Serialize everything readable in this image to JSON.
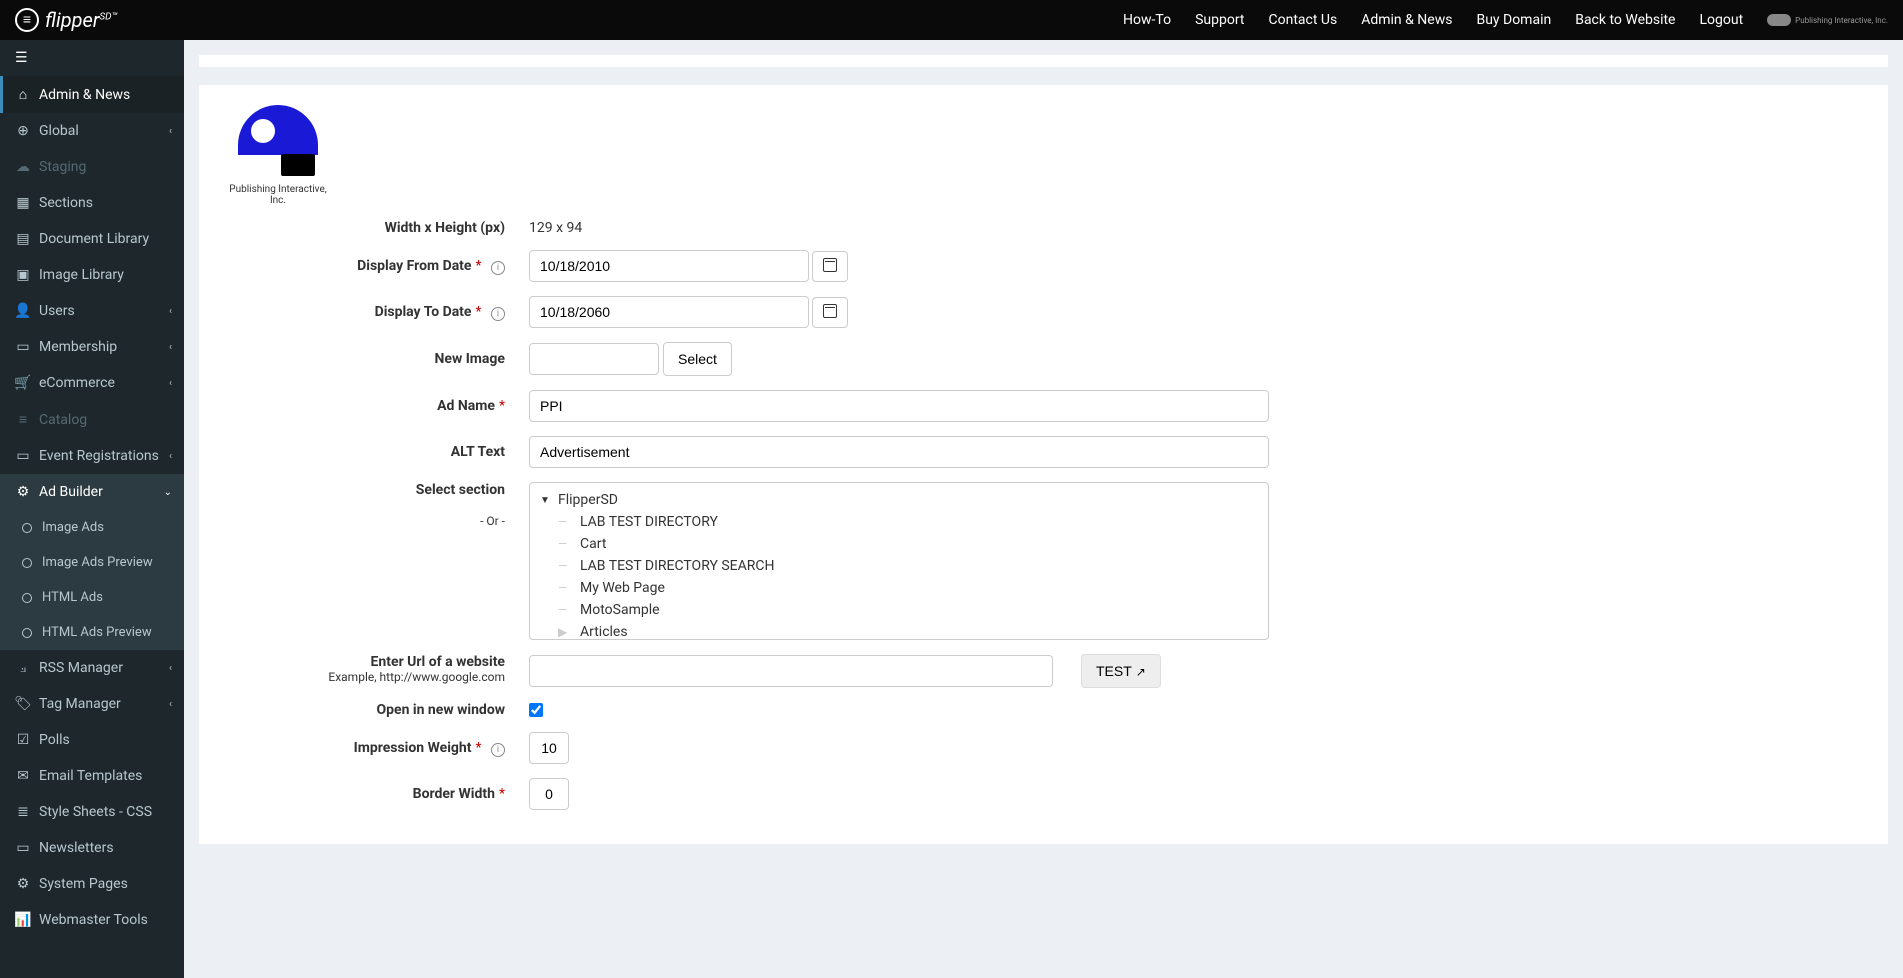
{
  "brand": {
    "name": "flipper",
    "suffix": "SD™"
  },
  "topNav": {
    "items": [
      "How-To",
      "Support",
      "Contact Us",
      "Admin & News",
      "Buy Domain",
      "Back to Website",
      "Logout"
    ],
    "partner": "Publishing Interactive, Inc."
  },
  "sidebar": {
    "items": [
      {
        "label": "Admin & News",
        "icon": "home",
        "active": true
      },
      {
        "label": "Global",
        "icon": "globe",
        "chevron": true
      },
      {
        "label": "Staging",
        "icon": "cloud",
        "muted": true
      },
      {
        "label": "Sections",
        "icon": "grid"
      },
      {
        "label": "Document Library",
        "icon": "file"
      },
      {
        "label": "Image Library",
        "icon": "image"
      },
      {
        "label": "Users",
        "icon": "user",
        "chevron": true
      },
      {
        "label": "Membership",
        "icon": "card",
        "chevron": true
      },
      {
        "label": "eCommerce",
        "icon": "cart",
        "chevron": true
      },
      {
        "label": "Catalog",
        "icon": "list",
        "muted": true
      },
      {
        "label": "Event Registrations",
        "icon": "calendar-rect",
        "chevron": true
      },
      {
        "label": "Ad Builder",
        "icon": "cogs",
        "expanded": true,
        "chevron": "down",
        "children": [
          {
            "label": "Image Ads"
          },
          {
            "label": "Image Ads Preview"
          },
          {
            "label": "HTML Ads"
          },
          {
            "label": "HTML Ads Preview"
          }
        ]
      },
      {
        "label": "RSS Manager",
        "icon": "rss",
        "chevron": true
      },
      {
        "label": "Tag Manager",
        "icon": "tag",
        "chevron": true
      },
      {
        "label": "Polls",
        "icon": "check-square"
      },
      {
        "label": "Email Templates",
        "icon": "envelope"
      },
      {
        "label": "Style Sheets - CSS",
        "icon": "layers"
      },
      {
        "label": "Newsletters",
        "icon": "news"
      },
      {
        "label": "System Pages",
        "icon": "cog"
      },
      {
        "label": "Webmaster Tools",
        "icon": "chart"
      }
    ]
  },
  "form": {
    "logoCaption": "Publishing Interactive, Inc.",
    "labels": {
      "widthHeight": "Width x Height (px)",
      "displayFrom": "Display From Date",
      "displayTo": "Display To Date",
      "newImage": "New Image",
      "adName": "Ad Name",
      "altText": "ALT Text",
      "selectSection": "Select section",
      "or": "- Or -",
      "enterUrl": "Enter Url of a website",
      "urlExample": "Example, http://www.google.com",
      "openNewWindow": "Open in new window",
      "impressionWeight": "Impression Weight",
      "borderWidth": "Border Width"
    },
    "values": {
      "dimensions": "129 x 94",
      "displayFrom": "10/18/2010",
      "displayTo": "10/18/2060",
      "newImage": "",
      "adName": "PPI",
      "altText": "Advertisement",
      "enterUrl": "",
      "openNewWindow": true,
      "impressionWeight": "10",
      "borderWidth": "0"
    },
    "buttons": {
      "select": "Select",
      "test": "TEST"
    },
    "tree": {
      "root": "FlipperSD",
      "children": [
        "LAB TEST DIRECTORY",
        "Cart",
        "LAB TEST DIRECTORY SEARCH",
        "My Web Page",
        "MotoSample",
        "Articles"
      ]
    }
  },
  "icons": {
    "home": "⌂",
    "globe": "⊕",
    "cloud": "☁",
    "grid": "▦",
    "file": "▤",
    "image": "▣",
    "user": "👤",
    "card": "▭",
    "cart": "🛒",
    "list": "≡",
    "calendar-rect": "▭",
    "cogs": "⚙",
    "rss": "⟓",
    "tag": "🏷",
    "check-square": "☑",
    "envelope": "✉",
    "layers": "≣",
    "news": "▭",
    "cog": "⚙",
    "chart": "📊"
  }
}
